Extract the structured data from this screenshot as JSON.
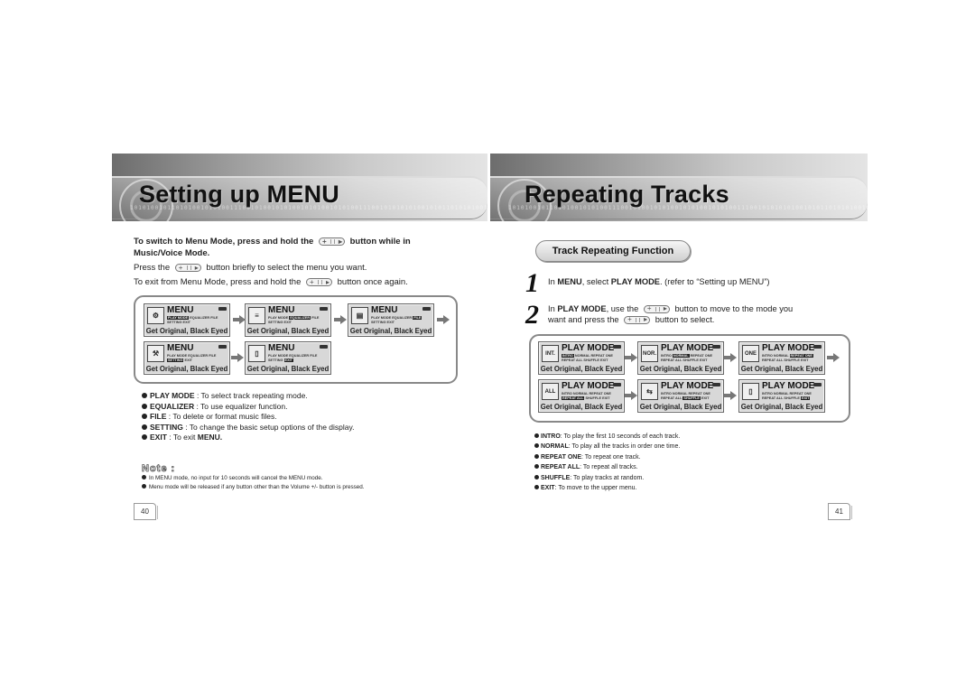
{
  "left_page": {
    "title": "Setting up MENU",
    "binary_pattern": "10101001011010100101010011100101001010100101010010101001110010101010100101011010101001010101001",
    "intro": {
      "line1_a": "To switch to Menu Mode, press and hold the",
      "line1_b": "button while in Music/Voice Mode.",
      "line2_a": "Press the",
      "line2_b": "button briefly to select the menu you want.",
      "line3_a": "To exit from Menu Mode, press and hold the",
      "line3_b": "button once again."
    },
    "screens": [
      {
        "title": "MENU",
        "icon": "play-mode-icon",
        "icon_glyph": "⚙",
        "opts_line1": [
          "PLAY MODE",
          "EQUALIZER",
          "FILE"
        ],
        "opts_line2": [
          "SETTING",
          "EXIT"
        ],
        "selected": "PLAY MODE",
        "song": "Get Original, Black Eyed"
      },
      {
        "title": "MENU",
        "icon": "equalizer-icon",
        "icon_glyph": "≡",
        "opts_line1": [
          "PLAY MODE",
          "EQUALIZER",
          "FILE"
        ],
        "opts_line2": [
          "SETTING",
          "EXIT"
        ],
        "selected": "EQUALIZER",
        "song": "Get Original, Black Eyed"
      },
      {
        "title": "MENU",
        "icon": "file-icon",
        "icon_glyph": "▤",
        "opts_line1": [
          "PLAY MODE",
          "EQUALIZER",
          "FILE"
        ],
        "opts_line2": [
          "SETTING",
          "EXIT"
        ],
        "selected": "FILE",
        "song": "Get Original, Black Eyed"
      },
      {
        "title": "MENU",
        "icon": "setting-icon",
        "icon_glyph": "⚒",
        "opts_line1": [
          "PLAY MODE",
          "EQUALIZER",
          "FILE"
        ],
        "opts_line2": [
          "SETTING",
          "EXIT"
        ],
        "selected": "SETTING",
        "song": "Get Original, Black Eyed"
      },
      {
        "title": "MENU",
        "icon": "exit-door-icon",
        "icon_glyph": "▯",
        "opts_line1": [
          "PLAY MODE",
          "EQUALIZER",
          "FILE"
        ],
        "opts_line2": [
          "SETTING",
          "EXIT"
        ],
        "selected": "EXIT",
        "song": "Get Original, Black Eyed"
      }
    ],
    "bullets": [
      {
        "term": "PLAY MODE",
        "desc": " : To select track repeating mode."
      },
      {
        "term": "EQUALIZER",
        "desc": " : To use equalizer function."
      },
      {
        "term": "FILE",
        "desc": " : To delete or format music files."
      },
      {
        "term": "SETTING",
        "desc": " : To change the basic setup options of the display."
      },
      {
        "term": "EXIT",
        "desc": " : To exit ",
        "term2": "MENU."
      }
    ],
    "note": {
      "heading": "Note :",
      "items": [
        "In MENU mode, no input for 10 seconds will cancel the MENU mode.",
        "Menu mode will be released if any button other than the Volume +/-  button is pressed."
      ]
    },
    "page_number": "40"
  },
  "right_page": {
    "title": "Repeating Tracks",
    "binary_pattern": "10101001011010100101010011100101001010100101010010101001110010101010100101011010101001010101001",
    "section_title": "Track Repeating Function",
    "steps": [
      {
        "num": "1",
        "parts": [
          "In ",
          "MENU",
          ", select ",
          "PLAY MODE",
          ". (refer to “Setting up MENU”)"
        ]
      },
      {
        "num": "2",
        "a_pre": "In ",
        "a_bold": "PLAY MODE",
        "a_post": ", use the",
        "a_after": "button to move to the mode you",
        "b_pre": "want and press the",
        "b_after": "button to select."
      }
    ],
    "screens": [
      {
        "title": "PLAY MODE",
        "icon": "intro-icon",
        "icon_glyph": "INT.",
        "opts_line1": [
          "INTRO",
          "NORMAL",
          "REPEAT ONE"
        ],
        "opts_line2": [
          "REPEAT ALL",
          "SHUFFLE",
          "EXIT"
        ],
        "selected": "INTRO",
        "song": "Get Original, Black Eyed"
      },
      {
        "title": "PLAY MODE",
        "icon": "normal-icon",
        "icon_glyph": "NOR.",
        "opts_line1": [
          "INTRO",
          "NORMAL",
          "REPEAT ONE"
        ],
        "opts_line2": [
          "REPEAT ALL",
          "SHUFFLE",
          "EXIT"
        ],
        "selected": "NORMAL",
        "song": "Get Original, Black Eyed"
      },
      {
        "title": "PLAY MODE",
        "icon": "repeat-one-icon",
        "icon_glyph": "ONE",
        "opts_line1": [
          "INTRO",
          "NORMAL",
          "REPEAT ONE"
        ],
        "opts_line2": [
          "REPEAT ALL",
          "SHUFFLE",
          "EXIT"
        ],
        "selected": "REPEAT ONE",
        "song": "Get Original, Black Eyed"
      },
      {
        "title": "PLAY MODE",
        "icon": "repeat-all-icon",
        "icon_glyph": "ALL",
        "opts_line1": [
          "INTRO",
          "NORMAL",
          "REPEAT ONE"
        ],
        "opts_line2": [
          "REPEAT ALL",
          "SHUFFLE",
          "EXIT"
        ],
        "selected": "REPEAT ALL",
        "song": "Get Original, Black Eyed"
      },
      {
        "title": "PLAY MODE",
        "icon": "shuffle-icon",
        "icon_glyph": "⇆",
        "opts_line1": [
          "INTRO",
          "NORMAL",
          "REPEAT ONE"
        ],
        "opts_line2": [
          "REPEAT ALL",
          "SHUFFLE",
          "EXIT"
        ],
        "selected": "SHUFFLE",
        "song": "Get Original, Black Eyed"
      },
      {
        "title": "PLAY MODE",
        "icon": "exit-door-icon",
        "icon_glyph": "▯",
        "opts_line1": [
          "INTRO",
          "NORMAL",
          "REPEAT ONE"
        ],
        "opts_line2": [
          "REPEAT ALL",
          "SHUFFLE",
          "EXIT"
        ],
        "selected": "EXIT",
        "song": "Get Original, Black Eyed"
      }
    ],
    "bullets": [
      {
        "term": "INTRO",
        "desc": ": To play the first 10 seconds of each track."
      },
      {
        "term": "NORMAL",
        "desc": ": To play all the tracks in order one time."
      },
      {
        "term": "REPEAT ONE",
        "desc": ": To repeat one track."
      },
      {
        "term": "REPEAT ALL",
        "desc": ": To repeat all tracks."
      },
      {
        "term": "SHUFFLE",
        "desc": ": To play tracks at random."
      },
      {
        "term": "EXIT",
        "desc": ": To move to the upper menu."
      }
    ],
    "page_number": "41"
  }
}
